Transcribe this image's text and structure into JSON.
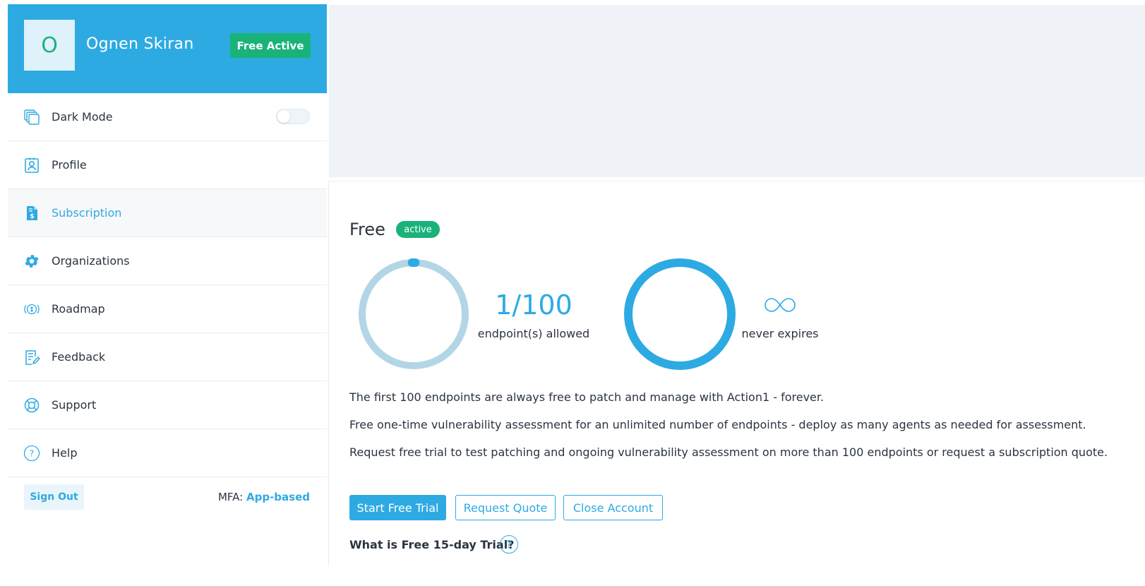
{
  "user": {
    "initial": "O",
    "name": "Ognen Skiran",
    "plan_badge": "Free Active"
  },
  "menu": {
    "dark_mode": "Dark Mode",
    "items": [
      {
        "label": "Profile",
        "icon": "profile-icon"
      },
      {
        "label": "Subscription",
        "icon": "subscription-icon",
        "active": true
      },
      {
        "label": "Organizations",
        "icon": "gear-icon"
      },
      {
        "label": "Roadmap",
        "icon": "roadmap-icon"
      },
      {
        "label": "Feedback",
        "icon": "feedback-icon"
      },
      {
        "label": "Support",
        "icon": "lifebuoy-icon"
      },
      {
        "label": "Help",
        "icon": "help-icon"
      }
    ]
  },
  "footer": {
    "sign_out": "Sign Out",
    "mfa_label": "MFA:",
    "mfa_value": "App-based"
  },
  "plan": {
    "name": "Free",
    "status": "active",
    "endpoints_used": 1,
    "endpoints_total": 100,
    "endpoints_count": "1/100",
    "endpoints_label": "endpoint(s) allowed",
    "expires_label": "never expires"
  },
  "description": {
    "line1": "The first 100 endpoints are always free to patch and manage with Action1 - forever.",
    "line2": "Free one-time vulnerability assessment for an unlimited number of endpoints - deploy as many agents as needed for assessment.",
    "line3": "Request free trial to test patching and ongoing vulnerability assessment on more than 100 endpoints or request a subscription quote."
  },
  "actions": {
    "start_trial": "Start Free Trial",
    "request_quote": "Request Quote",
    "close_account": "Close Account"
  },
  "trial_question": "What is Free 15-day Trial?",
  "help_glyph": "?",
  "colors": {
    "brand_blue": "#2eaae3",
    "success_green": "#19b37a",
    "ring_light": "#b3d6e6"
  }
}
